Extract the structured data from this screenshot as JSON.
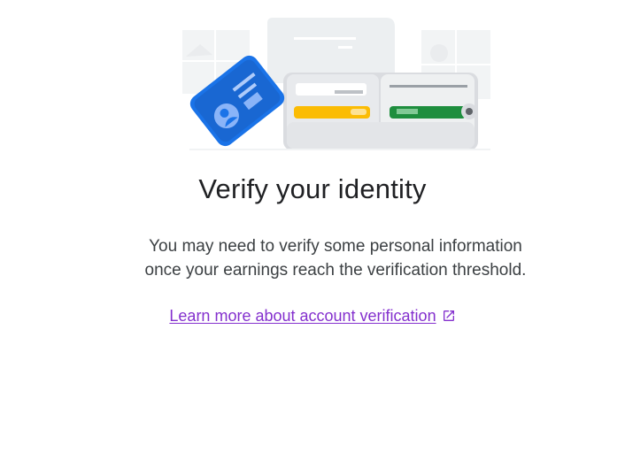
{
  "title": "Verify your identity",
  "description": "You may need to verify some personal information once your earnings reach the verification threshold.",
  "learn_more": {
    "label": "Learn more about account verification",
    "icon": "open-in-new-icon"
  },
  "illustration": {
    "icon": "identity-card-wallet-illustration",
    "colors": {
      "card_blue": "#1a73e8",
      "card_yellow": "#fbbc04",
      "card_green": "#1e8e3e",
      "wallet_gray": "#e8eaed"
    }
  },
  "colors": {
    "title": "#202124",
    "body": "#3c4043",
    "link": "#8430ce"
  }
}
